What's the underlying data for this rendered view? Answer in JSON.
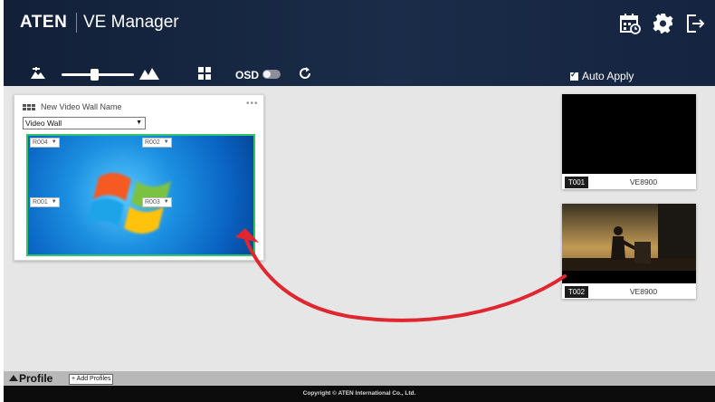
{
  "header": {
    "logo": "ATEN",
    "app_title": "VE Manager",
    "icons": [
      "calendar-icon",
      "gear-icon",
      "exit-icon"
    ]
  },
  "toolbar": {
    "osd_label": "OSD",
    "osd_enabled": false,
    "zoom_level": 0.45,
    "auto_apply_label": "Auto Apply",
    "auto_apply_checked": true
  },
  "video_wall": {
    "name": "New Video Wall Name",
    "type_select": "Video Wall",
    "receivers": [
      "R004",
      "R002",
      "R001",
      "R003"
    ]
  },
  "transmitters": [
    {
      "id": "T001",
      "model": "VE8900"
    },
    {
      "id": "T002",
      "model": "VE8900"
    }
  ],
  "profile": {
    "label": "Profile",
    "add_label": "+ Add Profiles"
  },
  "footer": {
    "copyright": "Copyright © ATEN International Co., Ltd."
  },
  "colors": {
    "header_bg": "#1a2c49",
    "wall_border": "#2fc56c",
    "arrow": "#e0262f"
  }
}
